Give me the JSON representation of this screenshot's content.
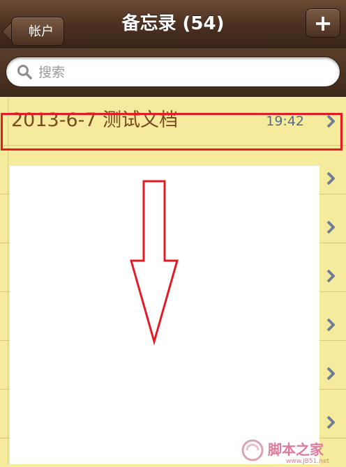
{
  "navbar": {
    "back_label": "帐户",
    "title": "备忘录 (54)",
    "add_label": "+"
  },
  "search": {
    "placeholder": "搜索",
    "value": ""
  },
  "notes": [
    {
      "title": "2013-6-7 测试文档",
      "time": "19:42",
      "highlighted": true
    }
  ],
  "colors": {
    "highlight": "#e41b24",
    "note_text": "#7a4a22",
    "time_text": "#576b87",
    "paper": "#f6eb9c"
  },
  "watermark": {
    "text": "脚本之家",
    "url_text": "www.JB51.net"
  }
}
